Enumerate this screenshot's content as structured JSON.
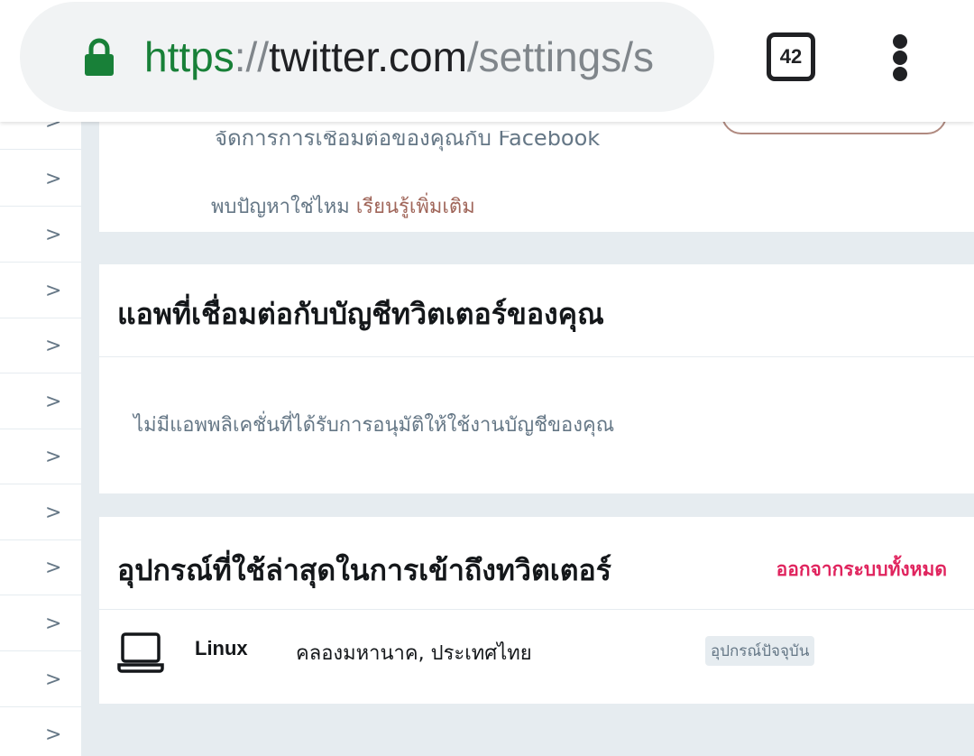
{
  "browser": {
    "url_scheme": "https",
    "url_sep": "://",
    "url_host": "twitter.com",
    "url_path": "/settings/s",
    "tab_count": "42",
    "icons": [
      "lock-icon",
      "tab-switcher-icon",
      "overflow-menu-icon"
    ]
  },
  "leftnav": {
    "chevron": ">",
    "row_count_visible": 11
  },
  "facebook_panel": {
    "cut_text": "จัดการการเชื่อมต่อของคุณกับ Facebook",
    "help_text": "พบปัญหาใช่ไหม",
    "learn_more": "เรียนรู้เพิ่มเติม"
  },
  "apps_panel": {
    "title": "แอพที่เชื่อมต่อกับบัญชีทวิตเตอร์ของคุณ",
    "empty_message": "ไม่มีแอพพลิเคชั่นที่ได้รับการอนุมัติให้ใช้งานบัญชีของคุณ"
  },
  "devices_panel": {
    "title": "อุปกรณ์ที่ใช้ล่าสุดในการเข้าถึงทวิตเตอร์",
    "logout_all": "ออกจากระบบทั้งหมด",
    "devices": [
      {
        "icon": "laptop-icon",
        "name": "Linux",
        "location": "คลองมหานาค, ประเทศไทย",
        "badge": "อุปกรณ์ปัจจุบัน"
      }
    ]
  },
  "colors": {
    "accent_link": "#a0665a",
    "danger": "#e0245e",
    "secure_green": "#188038"
  }
}
